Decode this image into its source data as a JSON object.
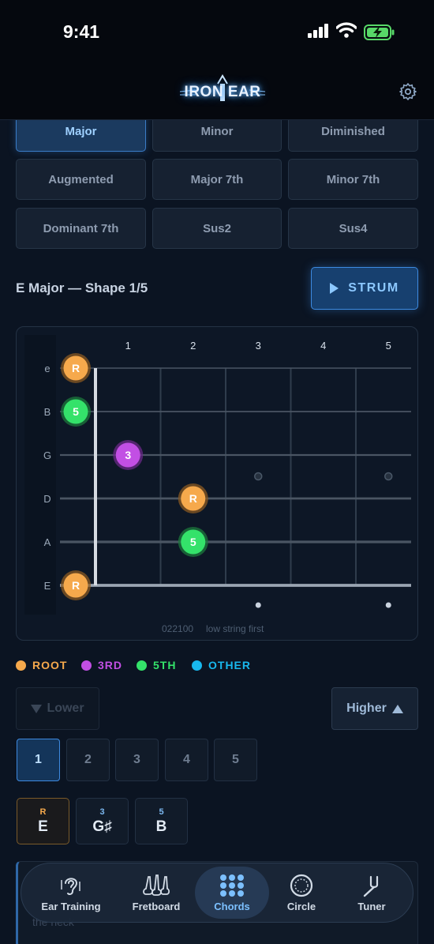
{
  "status": {
    "time": "9:41"
  },
  "header": {
    "logo_text": "IRON EAR"
  },
  "chord_types": [
    {
      "label": "Major",
      "active": true
    },
    {
      "label": "Minor",
      "active": false
    },
    {
      "label": "Diminished",
      "active": false
    },
    {
      "label": "Augmented",
      "active": false
    },
    {
      "label": "Major 7th",
      "active": false
    },
    {
      "label": "Minor 7th",
      "active": false
    },
    {
      "label": "Dominant 7th",
      "active": false
    },
    {
      "label": "Sus2",
      "active": false
    },
    {
      "label": "Sus4",
      "active": false
    }
  ],
  "shape": {
    "title": "E Major — Shape 1/5",
    "strum_label": "STRUM"
  },
  "fretboard": {
    "fret_numbers": [
      "1",
      "2",
      "3",
      "4",
      "5"
    ],
    "strings": [
      "e",
      "B",
      "G",
      "D",
      "A",
      "E"
    ],
    "notes": [
      {
        "string": 0,
        "fret": 0,
        "label": "R",
        "role": "root"
      },
      {
        "string": 1,
        "fret": 0,
        "label": "5",
        "role": "fifth"
      },
      {
        "string": 2,
        "fret": 1,
        "label": "3",
        "role": "third"
      },
      {
        "string": 3,
        "fret": 2,
        "label": "R",
        "role": "root"
      },
      {
        "string": 4,
        "fret": 2,
        "label": "5",
        "role": "fifth"
      },
      {
        "string": 5,
        "fret": 0,
        "label": "R",
        "role": "root"
      }
    ],
    "inlays": [
      3,
      5
    ],
    "caption": "022100",
    "caption_note": "low string first"
  },
  "legend": [
    {
      "label": "ROOT",
      "color": "#f6a94c"
    },
    {
      "label": "3RD",
      "color": "#c24fe4"
    },
    {
      "label": "5TH",
      "color": "#34e26a"
    },
    {
      "label": "OTHER",
      "color": "#18b8ee"
    }
  ],
  "position": {
    "lower": "Lower",
    "higher": "Higher"
  },
  "shape_numbers": [
    "1",
    "2",
    "3",
    "4",
    "5"
  ],
  "chord_notes": [
    {
      "degree": "R",
      "note": "E",
      "color": "#f6a94c"
    },
    {
      "degree": "3",
      "note": "G♯",
      "color": "#7cb8f0"
    },
    {
      "degree": "5",
      "note": "B",
      "color": "#7cb8f0"
    }
  ],
  "bottom_hint": "the neck",
  "tabs": [
    {
      "label": "Ear Training",
      "icon": "ear-icon",
      "active": false
    },
    {
      "label": "Fretboard",
      "icon": "guitars-icon",
      "active": false
    },
    {
      "label": "Chords",
      "icon": "grid-dots-icon",
      "active": true
    },
    {
      "label": "Circle",
      "icon": "circle-icon",
      "active": false
    },
    {
      "label": "Tuner",
      "icon": "tuning-fork-icon",
      "active": false
    }
  ]
}
